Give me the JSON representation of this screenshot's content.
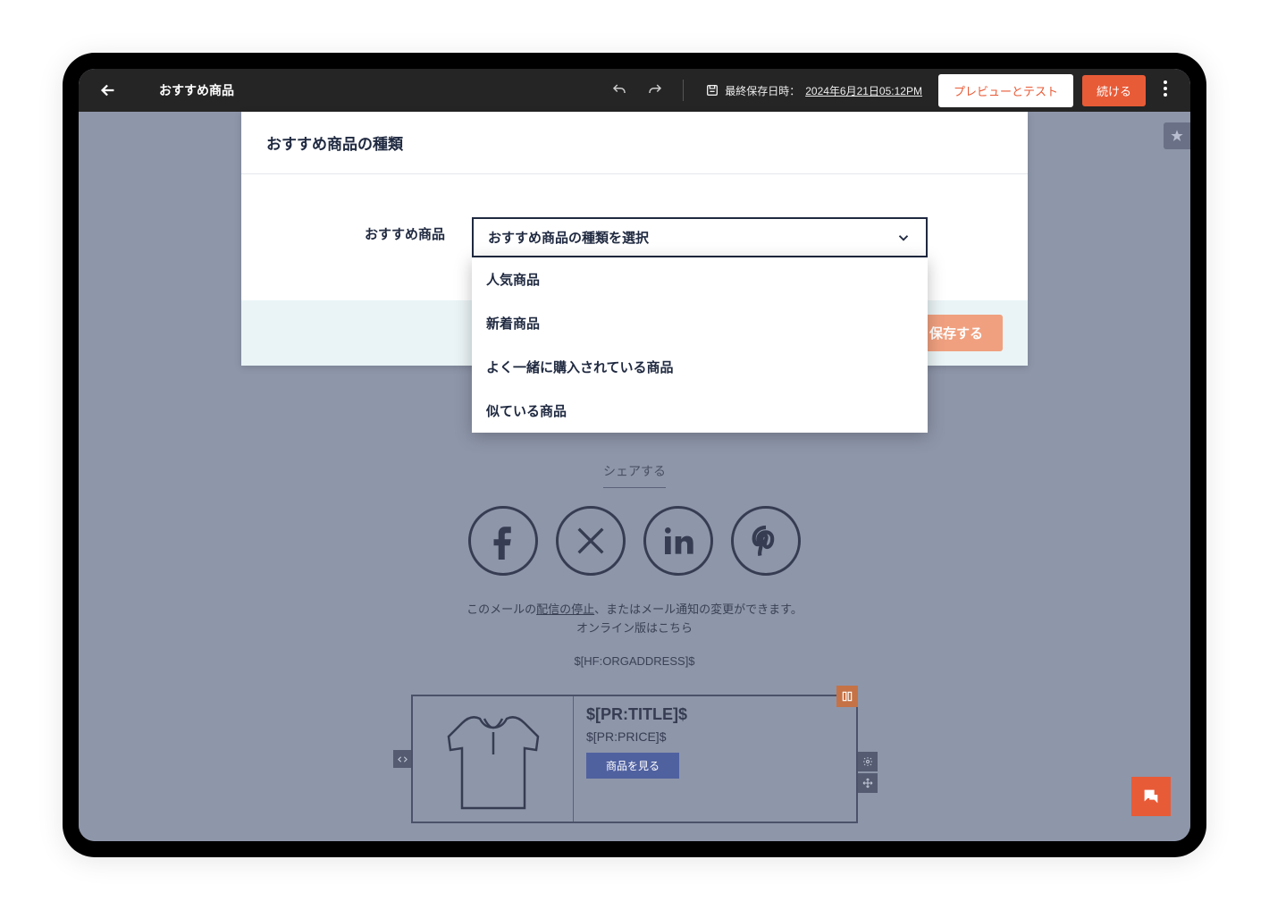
{
  "header": {
    "page_title": "おすすめ商品",
    "last_saved_prefix": "最終保存日時：",
    "last_saved_time": "2024年6月21日05:12PM",
    "preview_test_label": "プレビューとテスト",
    "continue_label": "続ける"
  },
  "panel": {
    "title": "おすすめ商品の種類",
    "field_label": "おすすめ商品",
    "select_placeholder": "おすすめ商品の種類を選択",
    "options": [
      "人気商品",
      "新着商品",
      "よく一緒に購入されている商品",
      "似ている商品"
    ],
    "save_button": "保存する"
  },
  "email": {
    "share_title": "シェアする",
    "footer_line1_prefix": "このメールの",
    "footer_unsubscribe": "配信の停止",
    "footer_line1_suffix": "、またはメール通知の変更ができます。",
    "footer_line2": "オンライン版はこちら",
    "org_address": "$[HF:ORGADDRESS]$"
  },
  "product": {
    "title": "$[PR:TITLE]$",
    "price": "$[PR:PRICE]$",
    "view_button": "商品を見る"
  }
}
